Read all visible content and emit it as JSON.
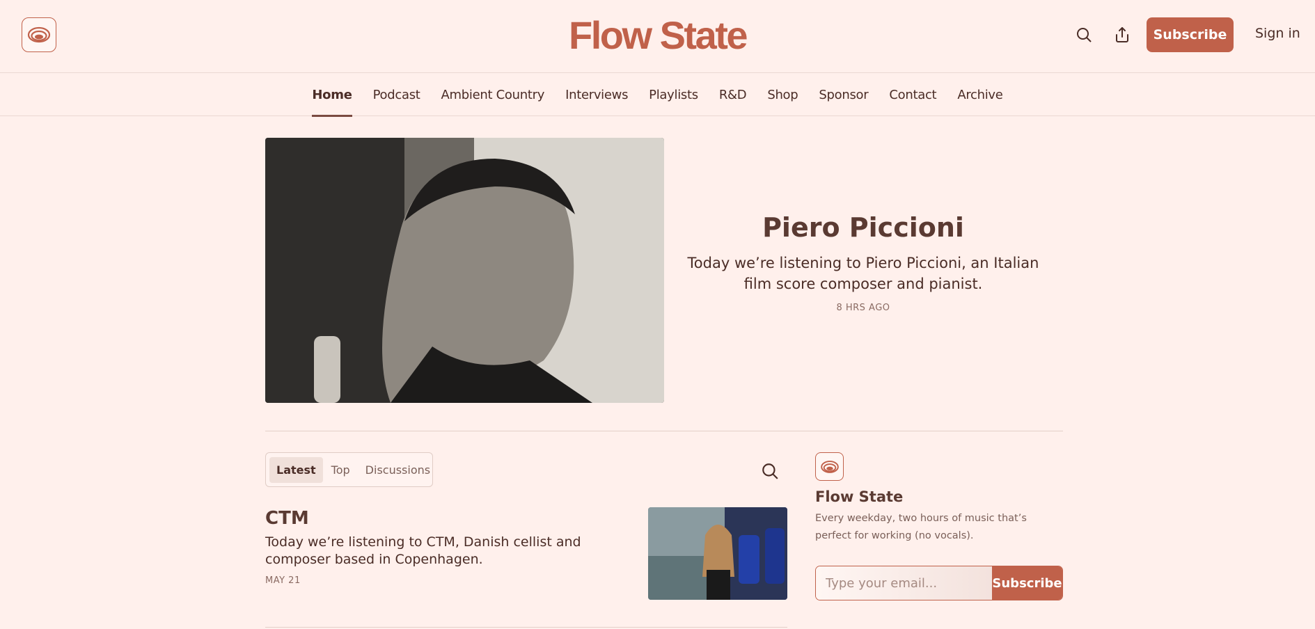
{
  "brand": {
    "title": "Flow State",
    "logo_icon": "flow-state-logo-icon",
    "accent": "#c0614a"
  },
  "header": {
    "search_icon": "search-icon",
    "share_icon": "share-icon",
    "subscribe_label": "Subscribe",
    "signin_label": "Sign in"
  },
  "nav": {
    "items": [
      {
        "label": "Home",
        "active": true
      },
      {
        "label": "Podcast"
      },
      {
        "label": "Ambient Country"
      },
      {
        "label": "Interviews"
      },
      {
        "label": "Playlists"
      },
      {
        "label": "R&D"
      },
      {
        "label": "Shop"
      },
      {
        "label": "Sponsor"
      },
      {
        "label": "Contact"
      },
      {
        "label": "Archive"
      }
    ]
  },
  "hero": {
    "title": "Piero Piccioni",
    "description": "Today we’re listening to Piero Piccioni, an Italian film score composer and pianist.",
    "meta": "8 HRS AGO"
  },
  "tabs": {
    "items": [
      {
        "label": "Latest",
        "active": true
      },
      {
        "label": "Top"
      },
      {
        "label": "Discussions"
      }
    ],
    "search_icon": "search-icon"
  },
  "posts": [
    {
      "title": "CTM",
      "description": "Today we’re listening to CTM, Danish cellist and composer based in Copenhagen.",
      "date": "MAY 21"
    }
  ],
  "sidebar": {
    "title": "Flow State",
    "description": "Every weekday, two hours of music that’s perfect for working (no vocals).",
    "email_placeholder": "Type your email...",
    "subscribe_label": "Subscribe"
  }
}
